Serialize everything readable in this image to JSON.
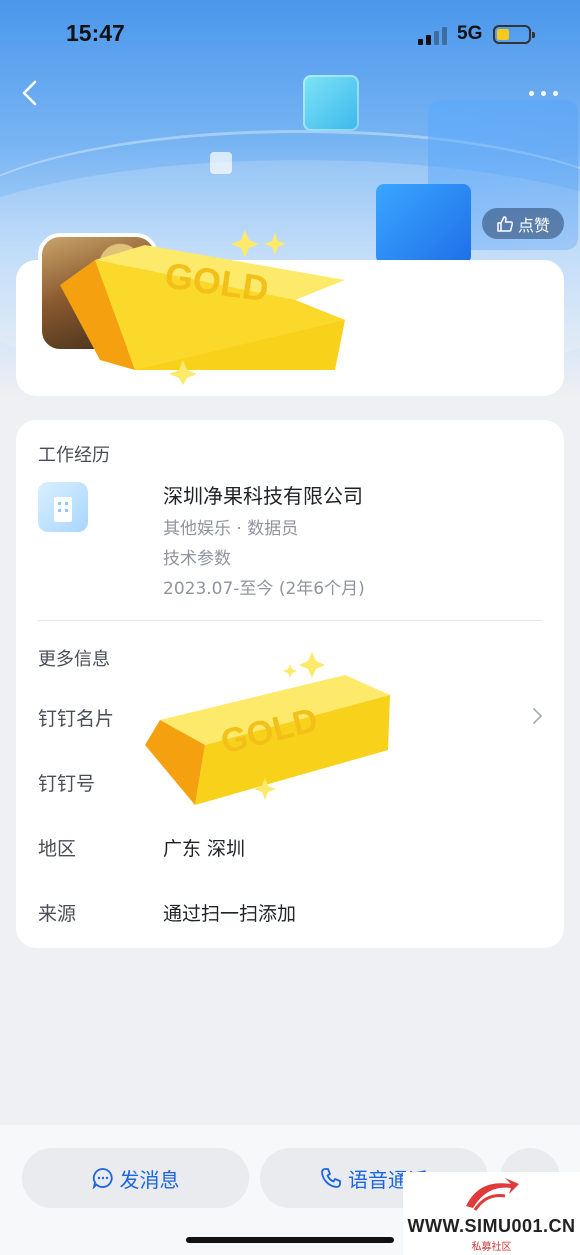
{
  "status_bar": {
    "time": "15:47",
    "network": "5G"
  },
  "header": {
    "like_label": "点赞"
  },
  "work": {
    "section_title": "工作经历",
    "company": "深圳净果科技有限公司",
    "industry_role": "其他娱乐 · 数据员",
    "department": "技术参数",
    "period": "2023.07-至今 (2年6个月)"
  },
  "more_info": {
    "section_title": "更多信息",
    "rows": [
      {
        "label": "钉钉名片",
        "value": ""
      },
      {
        "label": "钉钉号",
        "value": ""
      },
      {
        "label": "地区",
        "value": "广东 深圳"
      },
      {
        "label": "来源",
        "value": "通过扫一扫添加"
      }
    ]
  },
  "actions": {
    "message_label": "发消息",
    "call_label": "语音通话"
  },
  "sticker_text": "GOLD",
  "watermark": {
    "site": "WWW.SIMU001.CN",
    "sub": "私募社区"
  },
  "colors": {
    "accent": "#1a66e0",
    "header_top": "#4b97ec",
    "gold": "#f8d21a"
  }
}
